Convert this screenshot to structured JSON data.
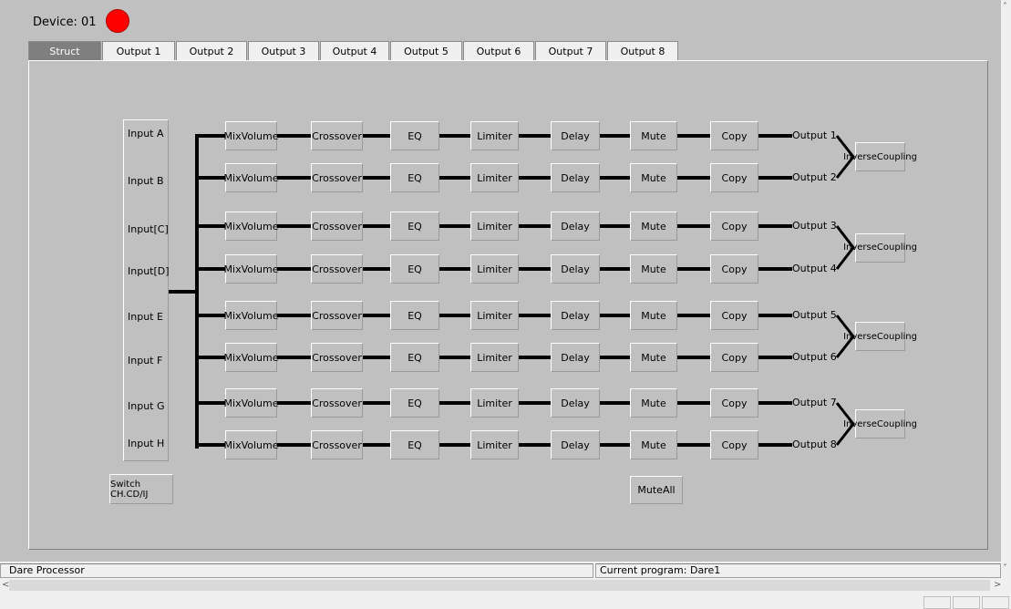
{
  "header": {
    "device_label": "Device: 01",
    "status_color": "#ff0000"
  },
  "tabs": [
    "Struct",
    "Output 1",
    "Output 2",
    "Output 3",
    "Output 4",
    "Output 5",
    "Output 6",
    "Output 7",
    "Output 8"
  ],
  "active_tab": "Struct",
  "inputs": [
    "Input A",
    "Input B",
    "Input[C]",
    "Input[D]",
    "Input E",
    "Input F",
    "Input G",
    "Input H"
  ],
  "channel_blocks": [
    "MixVolume",
    "Crossover",
    "EQ",
    "Limiter",
    "Delay",
    "Mute",
    "Copy"
  ],
  "outputs": [
    "Output 1",
    "Output 2",
    "Output 3",
    "Output 4",
    "Output 5",
    "Output 6",
    "Output 7",
    "Output 8"
  ],
  "coupling": {
    "label_line1": "Inverse",
    "label_line2": "Coupling",
    "count": 4
  },
  "buttons": {
    "switch": "Switch CH.CD/IJ",
    "mute_all": "MuteAll"
  },
  "statusbar": {
    "app_name": "Dare Processor",
    "program": "Current program: Dare1"
  }
}
